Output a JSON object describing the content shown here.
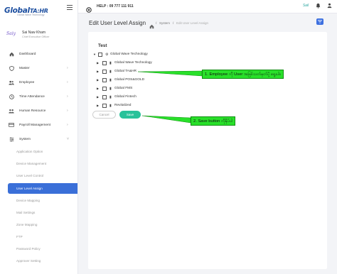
{
  "brand": {
    "logo_text": "Global",
    "logo_text_2": "TA:HR",
    "logo_sub": "Global Wave Technology",
    "avatar_sig": "Saiy"
  },
  "user": {
    "name": "Sai Naw Kham",
    "role": "Chief Executive Officer"
  },
  "topbar": {
    "help": "HELP : 09 777 111 911",
    "brand_mark": "Sail"
  },
  "nav": [
    {
      "label": "Dashboard",
      "icon": "home-icon"
    },
    {
      "label": "Master",
      "icon": "shield-icon"
    },
    {
      "label": "Employee",
      "icon": "users-icon"
    },
    {
      "label": "Time Attendance",
      "icon": "clock-icon"
    },
    {
      "label": "Human Resource",
      "icon": "people-icon"
    },
    {
      "label": "Payroll Management",
      "icon": "card-icon"
    },
    {
      "label": "System",
      "icon": "sliders-icon"
    }
  ],
  "system_sub": [
    "Application Option",
    "Device Management",
    "User Level Control",
    "User Level Assign",
    "Device Mapping",
    "Mail Settings",
    "Zone Mapping",
    "FTP",
    "Password Policy",
    "Approver Setting"
  ],
  "header": {
    "title": "Edit User Level Assign",
    "breadcrumb": [
      "System",
      "Edit User Level Assign"
    ]
  },
  "card": {
    "title": "Test"
  },
  "tree": {
    "root": "Global Wave Technology",
    "children": [
      "Global Wave Technology",
      "Global TA&HR",
      "Global POS&GOLD",
      "Global FMS",
      "Global Fintech",
      "Revitalized"
    ]
  },
  "buttons": {
    "cancel": "Cancel",
    "save": "Save"
  },
  "annotations": {
    "one": "1. Employee ကို User အဖြစ်သတ်မှတ်ပို့ ရွေးပါ။",
    "two": "2. Save button ကိုနှိပ်ပါ"
  },
  "colors": {
    "accent": "#3a6fd8",
    "save": "#29c29a",
    "annotation": "#29e02a"
  }
}
